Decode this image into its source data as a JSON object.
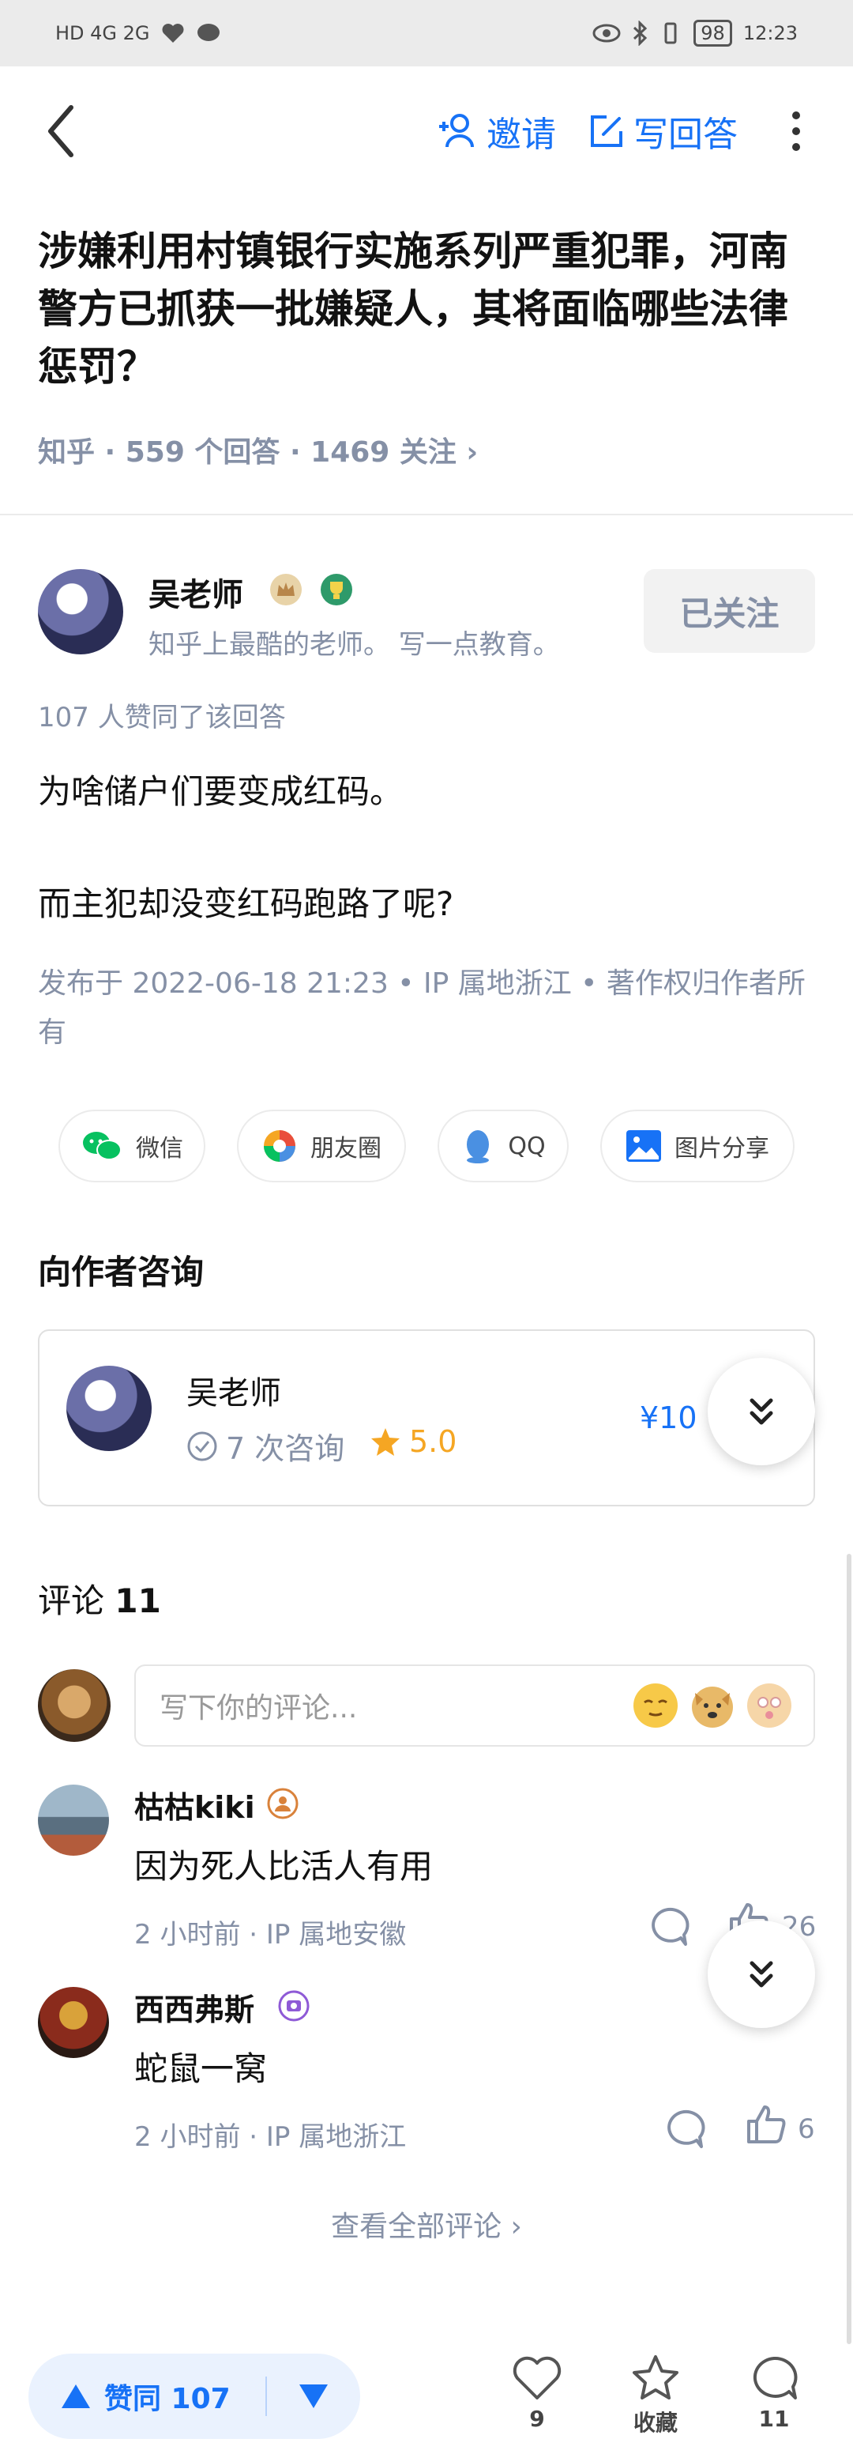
{
  "status_bar": {
    "left": "HD  4G  2G",
    "battery": "98",
    "time": "12:23"
  },
  "nav": {
    "invite_label": "邀请",
    "write_label": "写回答"
  },
  "question": {
    "title": "涉嫌利用村镇银行实施系列严重犯罪，河南警方已抓获一批嫌疑人，其将面临哪些法律惩罚？",
    "meta": "知乎 · 559 个回答 · 1469 关注 ›"
  },
  "author": {
    "name": "吴老师",
    "description": "知乎上最酷的老师。 写一点教育。",
    "follow_label": "已关注"
  },
  "answer": {
    "votes_line": "107 人赞同了该回答",
    "paragraphs": [
      "为啥储户们要变成红码。",
      "而主犯却没变红码跑路了呢?"
    ],
    "publish_info": "发布于 2022-06-18 21:23 • IP 属地浙江 • 著作权归作者所有"
  },
  "share": {
    "wechat": "微信",
    "moments": "朋友圈",
    "qq": "QQ",
    "image": "图片分享"
  },
  "consult": {
    "title": "向作者咨询",
    "name": "吴老师",
    "count": "7 次咨询",
    "rating": "5.0",
    "price": "¥10"
  },
  "comments": {
    "title_prefix": "评论",
    "count": "11",
    "input_placeholder": "写下你的评论...",
    "items": [
      {
        "name": "枯枯kiki",
        "text": "因为死人比活人有用",
        "meta": "2 小时前 · IP 属地安徽",
        "likes": "26"
      },
      {
        "name": "西西弗斯",
        "text": "蛇鼠一窝",
        "meta": "2 小时前 · IP 属地浙江",
        "likes": "6"
      }
    ],
    "view_all": "查看全部评论 ›"
  },
  "bottom_bar": {
    "vote_label": "赞同 107",
    "like_count": "9",
    "collect_label": "收藏",
    "comment_count": "11"
  },
  "colors": {
    "brand_blue": "#1772f6",
    "meta_gray": "#8590a6",
    "star_orange": "#f5a623"
  }
}
